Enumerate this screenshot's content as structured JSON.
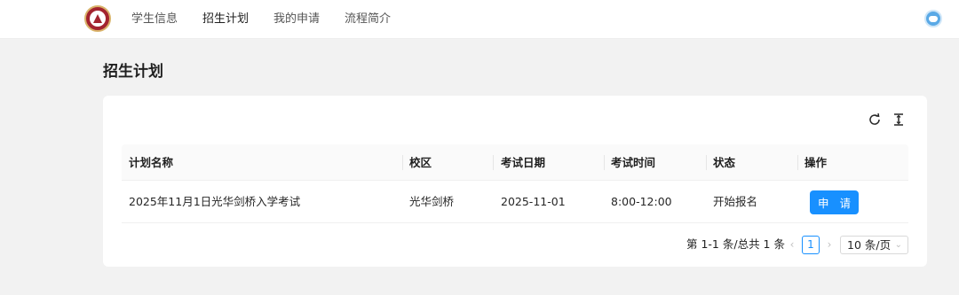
{
  "nav": {
    "items": [
      {
        "label": "学生信息",
        "active": false
      },
      {
        "label": "招生计划",
        "active": true
      },
      {
        "label": "我的申请",
        "active": false
      },
      {
        "label": "流程简介",
        "active": false
      }
    ]
  },
  "page": {
    "title": "招生计划"
  },
  "table": {
    "columns": [
      "计划名称",
      "校区",
      "考试日期",
      "考试时间",
      "状态",
      "操作"
    ],
    "rows": [
      {
        "name": "2025年11月1日光华剑桥入学考试",
        "campus": "光华剑桥",
        "date": "2025-11-01",
        "time": "8:00-12:00",
        "status": "开始报名",
        "action": "申 请"
      }
    ]
  },
  "pagination": {
    "total_text": "第 1-1 条/总共 1 条",
    "current_page": "1",
    "page_size": "10 条/页"
  },
  "colors": {
    "accent": "#1890ff",
    "brand": "#a3242f"
  },
  "icons": [
    "school-logo",
    "user-avatar-icon",
    "refresh-icon",
    "density-icon",
    "chevron-left-icon",
    "chevron-right-icon",
    "chevron-down-icon"
  ]
}
